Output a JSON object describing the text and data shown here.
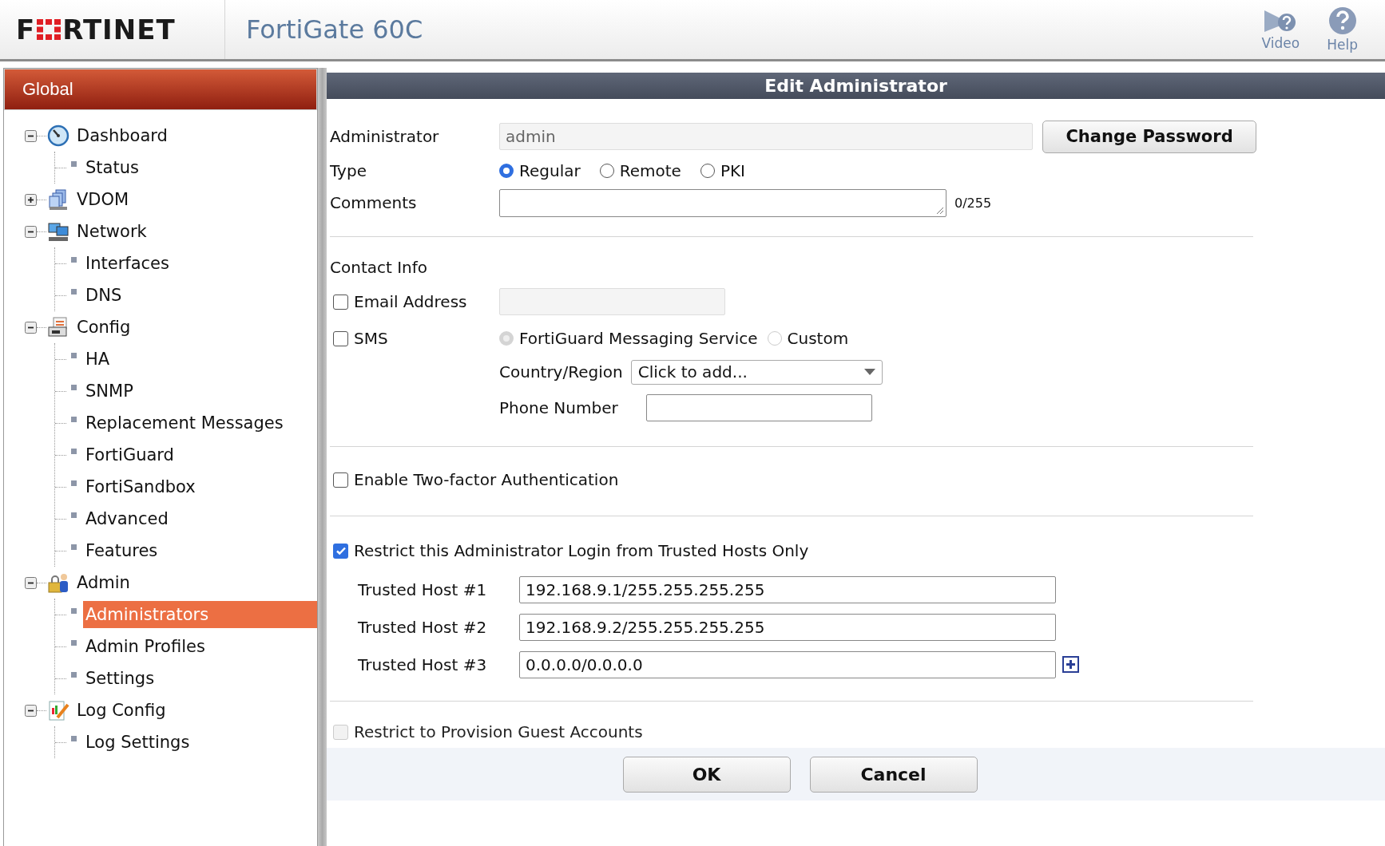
{
  "header": {
    "logo_left": "F",
    "logo_right": "RTINET",
    "product": "FortiGate 60C",
    "actions": [
      {
        "label": "Video"
      },
      {
        "label": "Help"
      }
    ]
  },
  "sidebar": {
    "title": "Global",
    "items": [
      {
        "label": "Dashboard",
        "expanded": true,
        "children": [
          {
            "label": "Status",
            "selected": false
          }
        ]
      },
      {
        "label": "VDOM",
        "expanded": false
      },
      {
        "label": "Network",
        "expanded": true,
        "children": [
          {
            "label": "Interfaces",
            "selected": false
          },
          {
            "label": "DNS",
            "selected": false
          }
        ]
      },
      {
        "label": "Config",
        "expanded": true,
        "children": [
          {
            "label": "HA",
            "selected": false
          },
          {
            "label": "SNMP",
            "selected": false
          },
          {
            "label": "Replacement Messages",
            "selected": false
          },
          {
            "label": "FortiGuard",
            "selected": false
          },
          {
            "label": "FortiSandbox",
            "selected": false
          },
          {
            "label": "Advanced",
            "selected": false
          },
          {
            "label": "Features",
            "selected": false
          }
        ]
      },
      {
        "label": "Admin",
        "expanded": true,
        "children": [
          {
            "label": "Administrators",
            "selected": true
          },
          {
            "label": "Admin Profiles",
            "selected": false
          },
          {
            "label": "Settings",
            "selected": false
          }
        ]
      },
      {
        "label": "Log Config",
        "expanded": true,
        "children": [
          {
            "label": "Log Settings",
            "selected": false
          }
        ]
      }
    ]
  },
  "form": {
    "title": "Edit Administrator",
    "administrator": {
      "label": "Administrator",
      "value": "admin"
    },
    "change_password": "Change Password",
    "type": {
      "label": "Type",
      "options": [
        {
          "label": "Regular",
          "selected": true
        },
        {
          "label": "Remote",
          "selected": false
        },
        {
          "label": "PKI",
          "selected": false
        }
      ]
    },
    "comments": {
      "label": "Comments",
      "counter": "0/255"
    },
    "contact_info": {
      "heading": "Contact Info",
      "email": {
        "label": "Email Address",
        "checked": false
      },
      "sms": {
        "label": "SMS",
        "checked": false,
        "options": [
          {
            "label": "FortiGuard Messaging Service",
            "selected": true
          },
          {
            "label": "Custom",
            "selected": false
          }
        ]
      },
      "country": {
        "label": "Country/Region",
        "value": "Click to add..."
      },
      "phone": {
        "label": "Phone Number"
      }
    },
    "two_factor": {
      "label": "Enable Two-factor Authentication",
      "checked": false
    },
    "trusted": {
      "label": "Restrict this Administrator Login from Trusted Hosts Only",
      "checked": true,
      "hosts": [
        {
          "label": "Trusted Host #1",
          "value": "192.168.9.1/255.255.255.255"
        },
        {
          "label": "Trusted Host #2",
          "value": "192.168.9.2/255.255.255.255"
        },
        {
          "label": "Trusted Host #3",
          "value": "0.0.0.0/0.0.0.0"
        }
      ]
    },
    "guest": {
      "label": "Restrict to Provision Guest Accounts",
      "checked": false,
      "disabled": true
    },
    "buttons": [
      {
        "label": "OK"
      },
      {
        "label": "Cancel"
      }
    ]
  }
}
